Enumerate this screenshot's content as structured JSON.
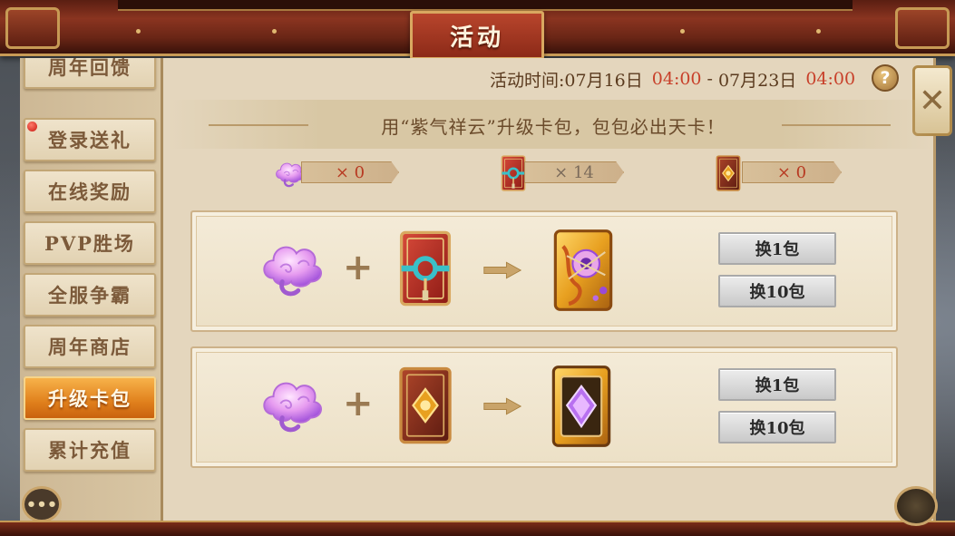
{
  "header": {
    "title": "活动"
  },
  "sidebar": {
    "items": [
      {
        "label": "周年回馈",
        "active": false,
        "badge": false
      },
      {
        "label": "登录送礼",
        "active": false,
        "badge": true
      },
      {
        "label": "在线奖励",
        "active": false,
        "badge": false
      },
      {
        "label": "PVP胜场",
        "active": false,
        "badge": false
      },
      {
        "label": "全服争霸",
        "active": false,
        "badge": false
      },
      {
        "label": "周年商店",
        "active": false,
        "badge": false
      },
      {
        "label": "升级卡包",
        "active": true,
        "badge": false
      },
      {
        "label": "累计充值",
        "active": false,
        "badge": false
      }
    ],
    "chat_icon": "chat-bubble-icon"
  },
  "event": {
    "time_label": "活动时间:",
    "start_date": "07月16日",
    "start_time": "04:00",
    "separator": "-",
    "end_date": "07月23日",
    "end_time": "04:00",
    "help_label": "?",
    "close_label": "✕",
    "subtitle": "用“紫气祥云”升级卡包，包包必出天卡！"
  },
  "counters": [
    {
      "icon": "purple-cloud-icon",
      "text": "× 0"
    },
    {
      "icon": "red-card-pack-icon",
      "text": "× 14"
    },
    {
      "icon": "brown-card-pack-icon",
      "text": "× 0"
    }
  ],
  "recipes": [
    {
      "inputs": [
        "purple-cloud-icon",
        "red-card-pack-icon"
      ],
      "output": "gold-orange-card-pack-icon",
      "plus": "+",
      "buttons": [
        "换1包",
        "换10包"
      ]
    },
    {
      "inputs": [
        "purple-cloud-icon",
        "brown-card-pack-icon"
      ],
      "output": "gold-purple-gem-card-pack-icon",
      "plus": "+",
      "buttons": [
        "换1包",
        "换10包"
      ]
    }
  ],
  "colors": {
    "accent_orange": "#e0801c",
    "highlight_red": "#c8402a",
    "panel_bg": "#e4d6bd",
    "title_plate": "#8c2a18"
  }
}
